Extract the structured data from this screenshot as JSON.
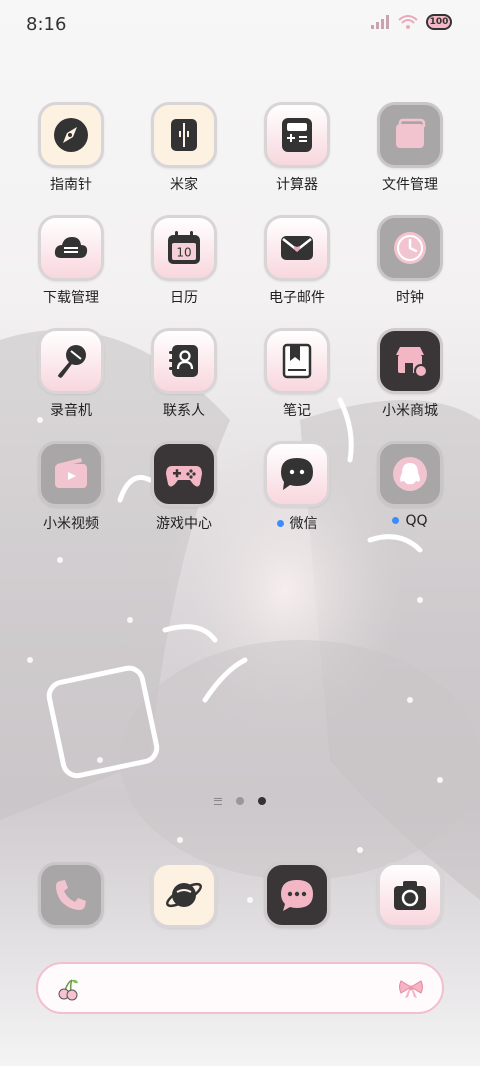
{
  "status_bar": {
    "time": "8:16",
    "battery": "100"
  },
  "apps": [
    {
      "label": "指南针",
      "icon": "compass-icon"
    },
    {
      "label": "米家",
      "icon": "mi-home-icon"
    },
    {
      "label": "计算器",
      "icon": "calculator-icon"
    },
    {
      "label": "文件管理",
      "icon": "folder-icon"
    },
    {
      "label": "下载管理",
      "icon": "download-cloud-icon"
    },
    {
      "label": "日历",
      "icon": "calendar-icon",
      "calendar_day": "10"
    },
    {
      "label": "电子邮件",
      "icon": "mail-icon"
    },
    {
      "label": "时钟",
      "icon": "clock-icon"
    },
    {
      "label": "录音机",
      "icon": "microphone-icon"
    },
    {
      "label": "联系人",
      "icon": "contacts-icon"
    },
    {
      "label": "笔记",
      "icon": "notes-icon"
    },
    {
      "label": "小米商城",
      "icon": "store-icon"
    },
    {
      "label": "小米视频",
      "icon": "video-icon"
    },
    {
      "label": "游戏中心",
      "icon": "gamepad-icon"
    },
    {
      "label": "微信",
      "icon": "chat-bubble-icon",
      "notification_dot": true
    },
    {
      "label": "QQ",
      "icon": "penguin-icon",
      "notification_dot": true
    }
  ],
  "dock": [
    {
      "icon": "phone-icon"
    },
    {
      "icon": "browser-planet-icon"
    },
    {
      "icon": "messages-icon"
    },
    {
      "icon": "camera-icon"
    }
  ],
  "page_indicator": {
    "pages": 2,
    "active_page": 2
  },
  "search_bar": {
    "left_icon": "cherry-icon",
    "right_icon": "bow-icon"
  },
  "colors": {
    "accent_pink": "#f4b8c7",
    "notification_dot": "#3b8cff",
    "dark_tile": "#3a3638"
  }
}
